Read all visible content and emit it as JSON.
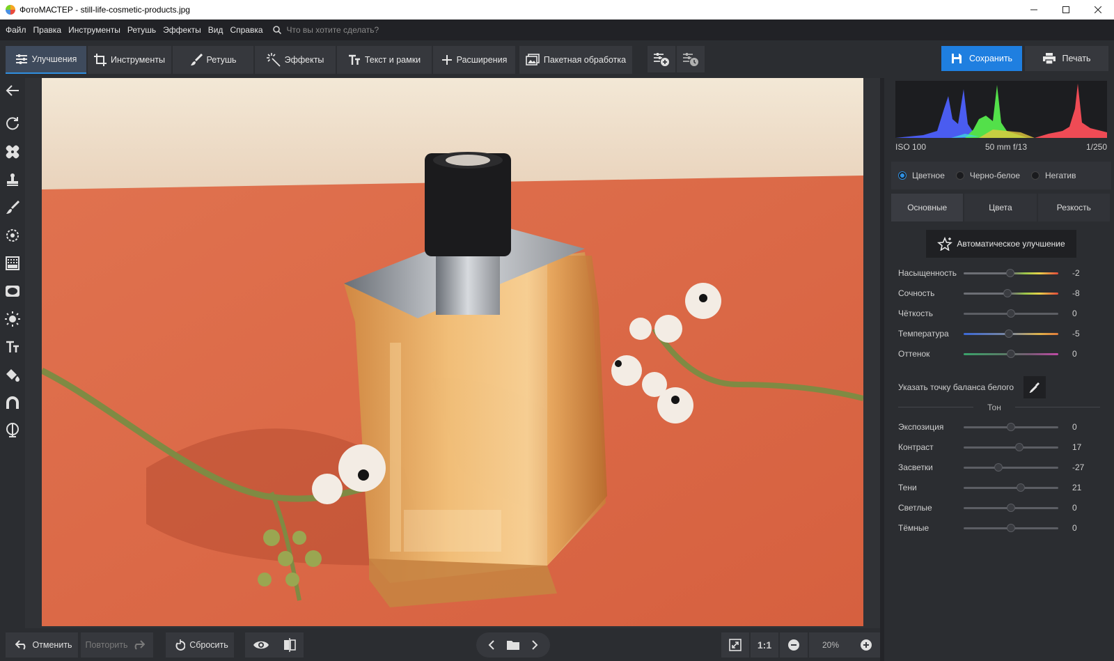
{
  "window": {
    "title": "ФотоМАСТЕР - still-life-cosmetic-products.jpg"
  },
  "menu": {
    "items": [
      "Файл",
      "Правка",
      "Инструменты",
      "Ретушь",
      "Эффекты",
      "Вид",
      "Справка"
    ],
    "search_placeholder": "Что вы хотите сделать?"
  },
  "toolbar": {
    "tabs": [
      {
        "label": "Улучшения",
        "active": true
      },
      {
        "label": "Инструменты"
      },
      {
        "label": "Ретушь"
      },
      {
        "label": "Эффекты"
      },
      {
        "label": "Текст и рамки"
      },
      {
        "label": "Расширения"
      },
      {
        "label": "Пакетная обработка"
      }
    ],
    "save_label": "Сохранить",
    "print_label": "Печать",
    "accent_color": "#1f7fe0"
  },
  "photo": {
    "subject": "perfume-bottle-with-flowers"
  },
  "bottom": {
    "undo_label": "Отменить",
    "redo_label": "Повторить",
    "reset_label": "Сбросить",
    "fit_label": "1:1",
    "zoom_value": "20%"
  },
  "panel": {
    "exif": {
      "iso": "ISO 100",
      "lens": "50 mm f/13",
      "shutter": "1/250"
    },
    "modes": [
      {
        "label": "Цветное",
        "checked": true
      },
      {
        "label": "Черно-белое",
        "checked": false
      },
      {
        "label": "Негатив",
        "checked": false
      }
    ],
    "subtabs": [
      {
        "label": "Основные",
        "active": true
      },
      {
        "label": "Цвета"
      },
      {
        "label": "Резкость"
      }
    ],
    "auto_label": "Автоматическое улучшение",
    "basic_sliders": [
      {
        "label": "Насыщенность",
        "value": "-2",
        "fraction": 0.49
      },
      {
        "label": "Сочность",
        "value": "-8",
        "fraction": 0.46
      },
      {
        "label": "Чёткость",
        "value": "0",
        "fraction": 0.5
      },
      {
        "label": "Температура",
        "value": "-5",
        "fraction": 0.48
      },
      {
        "label": "Оттенок",
        "value": "0",
        "fraction": 0.5
      }
    ],
    "wb_label": "Указать точку баланса белого",
    "tone_title": "Тон",
    "tone_sliders": [
      {
        "label": "Экспозиция",
        "value": "0",
        "fraction": 0.5
      },
      {
        "label": "Контраст",
        "value": "17",
        "fraction": 0.585
      },
      {
        "label": "Засветки",
        "value": "-27",
        "fraction": 0.365
      },
      {
        "label": "Тени",
        "value": "21",
        "fraction": 0.605
      },
      {
        "label": "Светлые",
        "value": "0",
        "fraction": 0.5
      },
      {
        "label": "Тёмные",
        "value": "0",
        "fraction": 0.5
      }
    ]
  }
}
